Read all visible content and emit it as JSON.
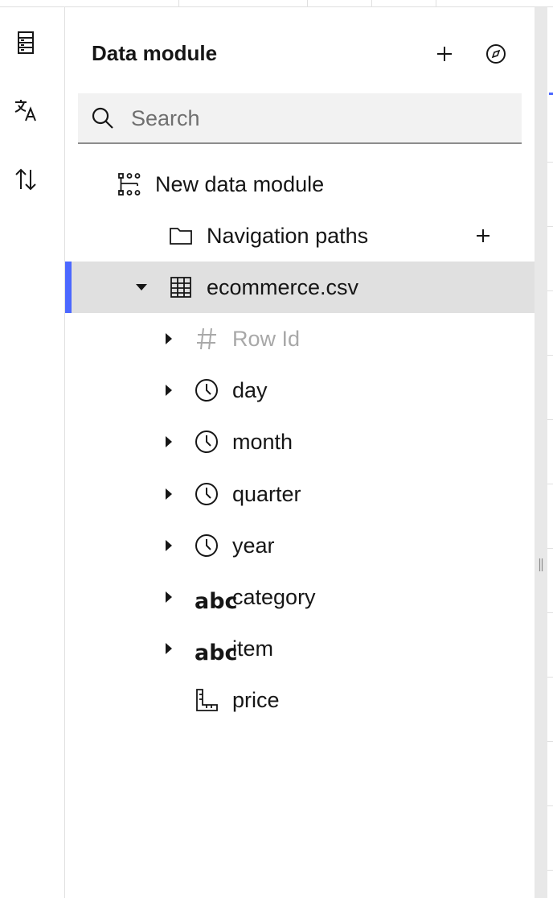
{
  "panel": {
    "title": "Data module",
    "add_icon": "plus-icon",
    "explore_icon": "compass-icon"
  },
  "rail": {
    "icons": [
      "data-table-icon",
      "translate-icon",
      "sort-arrows-icon"
    ]
  },
  "search": {
    "placeholder": "Search",
    "value": ""
  },
  "tree": {
    "root_label": "New data module",
    "nav_paths_label": "Navigation paths",
    "table_label": "ecommerce.csv",
    "columns": [
      {
        "label": "Row Id",
        "icon": "hash-icon"
      },
      {
        "label": "day",
        "icon": "clock-icon"
      },
      {
        "label": "month",
        "icon": "clock-icon"
      },
      {
        "label": "quarter",
        "icon": "clock-icon"
      },
      {
        "label": "year",
        "icon": "clock-icon"
      },
      {
        "label": "category",
        "icon": "abc-icon",
        "icon_text": "abc"
      },
      {
        "label": "item",
        "icon": "abc-icon",
        "icon_text": "abc"
      },
      {
        "label": "price",
        "icon": "ruler-icon"
      }
    ]
  },
  "colors": {
    "accent": "#4c68ff",
    "selected_bg": "#e0e0e0",
    "muted_text": "#a8a8a8"
  }
}
